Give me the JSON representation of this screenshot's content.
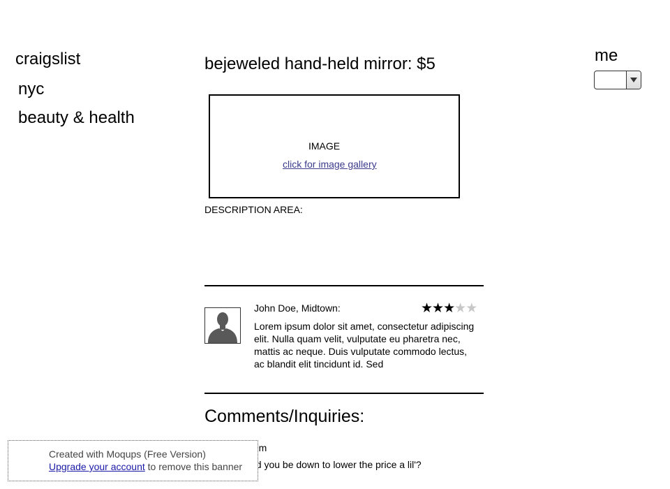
{
  "nav": {
    "site": "craigslist",
    "city": "nyc",
    "category": "beauty & health"
  },
  "user_menu": {
    "label": "me",
    "selected": ""
  },
  "listing": {
    "title": "bejeweled hand-held mirror: $5",
    "image_label": "IMAGE",
    "gallery_link": "click for image gallery",
    "description_label": "DESCRIPTION AREA:"
  },
  "review": {
    "reviewer": "John Doe, Midtown:",
    "rating": 3,
    "rating_max": 5,
    "text": "Lorem ipsum dolor sit amet, consectetur adipiscing elit. Nulla quam velit, vulputate eu pharetra nec, mattis ac neque. Duis vulputate commodo lectus, ac blandit elit tincidunt id. Sed"
  },
  "comments": {
    "title": "Comments/Inquiries:",
    "items": [
      {
        "author": "By Kim",
        "text": "would you be down to lower the price a lil'?"
      }
    ]
  },
  "banner": {
    "line1": "Created with Moqups (Free Version)",
    "link": "Upgrade your account",
    "suffix": " to remove this banner"
  },
  "icons": {
    "avatar": "person-silhouette-icon",
    "dropdown": "chevron-down-icon",
    "star": "star-icon"
  },
  "colors": {
    "star_on": "#000000",
    "star_off": "#c8c8c8",
    "link": "#3b3b8c"
  }
}
